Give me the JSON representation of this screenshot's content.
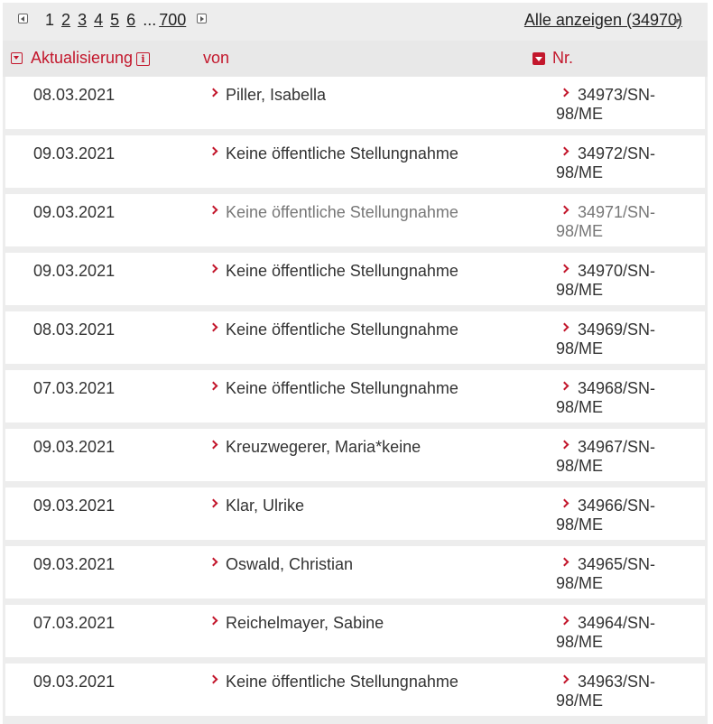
{
  "pagination": {
    "pages": [
      "1",
      "2",
      "3",
      "4",
      "5",
      "6"
    ],
    "ellipsis": "...",
    "last": "700",
    "show_all": "Alle anzeigen (34970)"
  },
  "columns": {
    "date": "Aktualisierung",
    "von": "von",
    "nr": "Nr."
  },
  "rows": [
    {
      "date": "08.03.2021",
      "von": "Piller, Isabella",
      "nr1": "34973/SN-",
      "nr2": "98/ME"
    },
    {
      "date": "09.03.2021",
      "von": "Keine öffentliche Stellungnahme",
      "nr1": "34972/SN-",
      "nr2": "98/ME"
    },
    {
      "date": "09.03.2021",
      "von": "Keine öffentliche Stellungnahme",
      "nr1": "34971/SN-",
      "nr2": "98/ME"
    },
    {
      "date": "09.03.2021",
      "von": "Keine öffentliche Stellungnahme",
      "nr1": "34970/SN-",
      "nr2": "98/ME"
    },
    {
      "date": "08.03.2021",
      "von": "Keine öffentliche Stellungnahme",
      "nr1": "34969/SN-",
      "nr2": "98/ME"
    },
    {
      "date": "07.03.2021",
      "von": "Keine öffentliche Stellungnahme",
      "nr1": "34968/SN-",
      "nr2": "98/ME"
    },
    {
      "date": "09.03.2021",
      "von": "Kreuzwegerer, Maria*keine",
      "nr1": "34967/SN-",
      "nr2": "98/ME"
    },
    {
      "date": "09.03.2021",
      "von": "Klar, Ulrike",
      "nr1": "34966/SN-",
      "nr2": "98/ME"
    },
    {
      "date": "09.03.2021",
      "von": "Oswald, Christian",
      "nr1": "34965/SN-",
      "nr2": "98/ME"
    },
    {
      "date": "07.03.2021",
      "von": "Reichelmayer, Sabine",
      "nr1": "34964/SN-",
      "nr2": "98/ME"
    },
    {
      "date": "09.03.2021",
      "von": "Keine öffentliche Stellungnahme",
      "nr1": "34963/SN-",
      "nr2": "98/ME"
    }
  ],
  "colors": {
    "accent": "#c3172c",
    "panel_bg": "#ededed"
  }
}
